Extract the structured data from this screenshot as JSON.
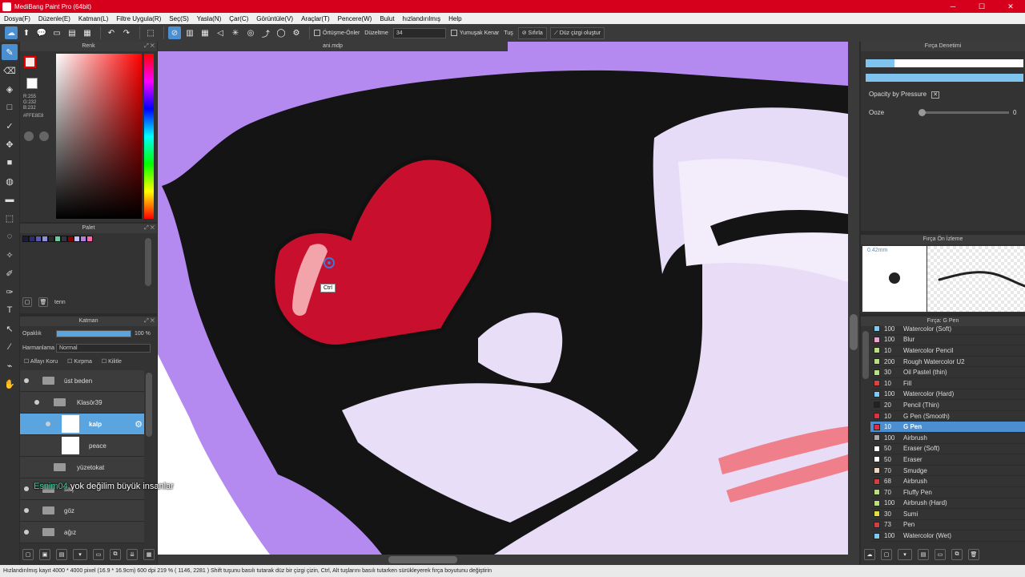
{
  "window": {
    "title": "MediBang Paint Pro (64bit)",
    "controls": [
      "─",
      "☐",
      "✕"
    ]
  },
  "menu": [
    "Dosya(F)",
    "Düzenle(E)",
    "Katman(L)",
    "Filtre Uygula(R)",
    "Seç(S)",
    "Yasla(N)",
    "Çar(C)",
    "Görüntüle(V)",
    "Araçlar(T)",
    "Pencere(W)",
    "Bulut",
    "hızlandırılmış",
    "Help"
  ],
  "toolbar": {
    "antialias_label": "Örtüşme-Önler",
    "correction_label": "Düzeltme",
    "correction_value": "34",
    "soft_edge_label": "Yumuşak Kenar",
    "tug_label": "Tuş",
    "reset_label": "Sıfırla",
    "straight_line_label": "Düz çizgi oluştur"
  },
  "color_panel": {
    "title": "Renk",
    "rgb": [
      "R:255",
      "G:232",
      "B:232"
    ],
    "hex": "#FFE8E8",
    "fg": "#ffe8e8",
    "bg": "#ffffff"
  },
  "palette_panel": {
    "title": "Palet",
    "name": "tenn",
    "swatches": [
      "#1b1b3a",
      "#2d2d6e",
      "#5a5ab5",
      "#8f8fe0",
      "#2c2c2c",
      "#66cc99",
      "#333344",
      "#8b0000",
      "#c0c0ff",
      "#b27fe0",
      "#ff66aa"
    ]
  },
  "layer_panel": {
    "title": "Katman",
    "opacity_label": "Opaklık",
    "opacity_value": "100 %",
    "opacity": 1.0,
    "blend_label": "Harmanlama",
    "blend_value": "Normal",
    "checks": [
      "Alfayı Koru",
      "Kırpma",
      "Kilitle"
    ],
    "layers": [
      {
        "name": "üst beden"
      },
      {
        "name": "Klasör39"
      },
      {
        "name": "kalp"
      },
      {
        "name": "peace"
      },
      {
        "name": "yüzetokat"
      },
      {
        "name": "saç"
      },
      {
        "name": "göz"
      },
      {
        "name": "ağız"
      }
    ]
  },
  "document": {
    "tab": "ani.mdp",
    "cursor_tip": "Ctrl"
  },
  "chat": {
    "user": "Esnim04",
    "message": "yok değilim büyük insanlar"
  },
  "brush_control": {
    "title": "Fırça Denetimi",
    "opacity_pressure": "Opacity by Pressure",
    "ooze_label": "Ooze",
    "ooze_value": "0"
  },
  "brush_preview": {
    "title": "Fırça Ön İzleme",
    "size": "0.42mm"
  },
  "brush_list": {
    "title": "Fırça: G Pen",
    "items": [
      {
        "size": "100",
        "name": "Watercolor (Soft)",
        "color": "#7ecbf0"
      },
      {
        "size": "100",
        "name": "Blur",
        "color": "#f0a0d0"
      },
      {
        "size": "10",
        "name": "Watercolor Pencil",
        "color": "#b8e080"
      },
      {
        "size": "200",
        "name": "Rough Watercolor U2",
        "color": "#b8e080"
      },
      {
        "size": "30",
        "name": "Oil Pastel (thin)",
        "color": "#b8e080"
      },
      {
        "size": "10",
        "name": "Fill",
        "color": "#e04040"
      },
      {
        "size": "100",
        "name": "Watercolor (Hard)",
        "color": "#7ecbf0"
      },
      {
        "size": "20",
        "name": "Pencil (Thin)",
        "color": "#222222"
      },
      {
        "size": "10",
        "name": "G Pen (Smooth)",
        "color": "#e03040"
      },
      {
        "size": "10",
        "name": "G Pen",
        "color": "#e03040"
      },
      {
        "size": "100",
        "name": "Airbrush",
        "color": "#aaaaaa"
      },
      {
        "size": "50",
        "name": "Eraser (Soft)",
        "color": "#ffffff"
      },
      {
        "size": "50",
        "name": "Eraser",
        "color": "#ffffff"
      },
      {
        "size": "70",
        "name": "Smudge",
        "color": "#f0d8c0"
      },
      {
        "size": "68",
        "name": "Airbrush",
        "color": "#d04040"
      },
      {
        "size": "70",
        "name": "Fluffy Pen",
        "color": "#b8e080"
      },
      {
        "size": "100",
        "name": "Airbrush (Hard)",
        "color": "#b8e080"
      },
      {
        "size": "30",
        "name": "Sumi",
        "color": "#e0e040"
      },
      {
        "size": "73",
        "name": "Pen",
        "color": "#d04040"
      },
      {
        "size": "100",
        "name": "Watercolor (Wet)",
        "color": "#7ecbf0"
      }
    ]
  },
  "status": "Hızlandırılmış kayıt   4000 * 4000 pixel  (16.9 * 16.9cm)  600 dpi  219 %  ( 1146, 2281 )  Shift tuşunu basılı tutarak düz bir çizgi çizin, Ctrl, Alt tuşlarını basılı tutarken sürükleyerek fırça boyutunu değiştirin"
}
